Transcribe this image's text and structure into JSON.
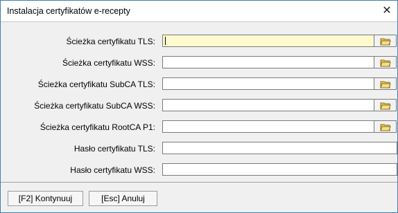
{
  "window": {
    "title": "Instalacja certyfikatów e-recepty",
    "close_glyph": "✕"
  },
  "fields": [
    {
      "label": "Ścieżka certyfikatu TLS:",
      "value": "",
      "browse_icon": "folder-icon"
    },
    {
      "label": "Ścieżka certyfikatu WSS:",
      "value": "",
      "browse_icon": "folder-icon"
    },
    {
      "label": "Ścieżka certyfikatu SubCA TLS:",
      "value": "",
      "browse_icon": "folder-icon"
    },
    {
      "label": "Ścieżka certyfikatu SubCA WSS:",
      "value": "",
      "browse_icon": "folder-icon"
    },
    {
      "label": "Ścieżka certyfikatu RootCA P1:",
      "value": "",
      "browse_icon": "folder-icon"
    },
    {
      "label": "Hasło certyfikatu TLS:",
      "value": ""
    },
    {
      "label": "Hasło certyfikatu WSS:",
      "value": ""
    }
  ],
  "buttons": {
    "continue": "[F2] Kontynuuj",
    "cancel": "[Esc] Anuluj"
  },
  "colors": {
    "active_field": "#fffacd",
    "window_border": "#3c7fb1"
  }
}
